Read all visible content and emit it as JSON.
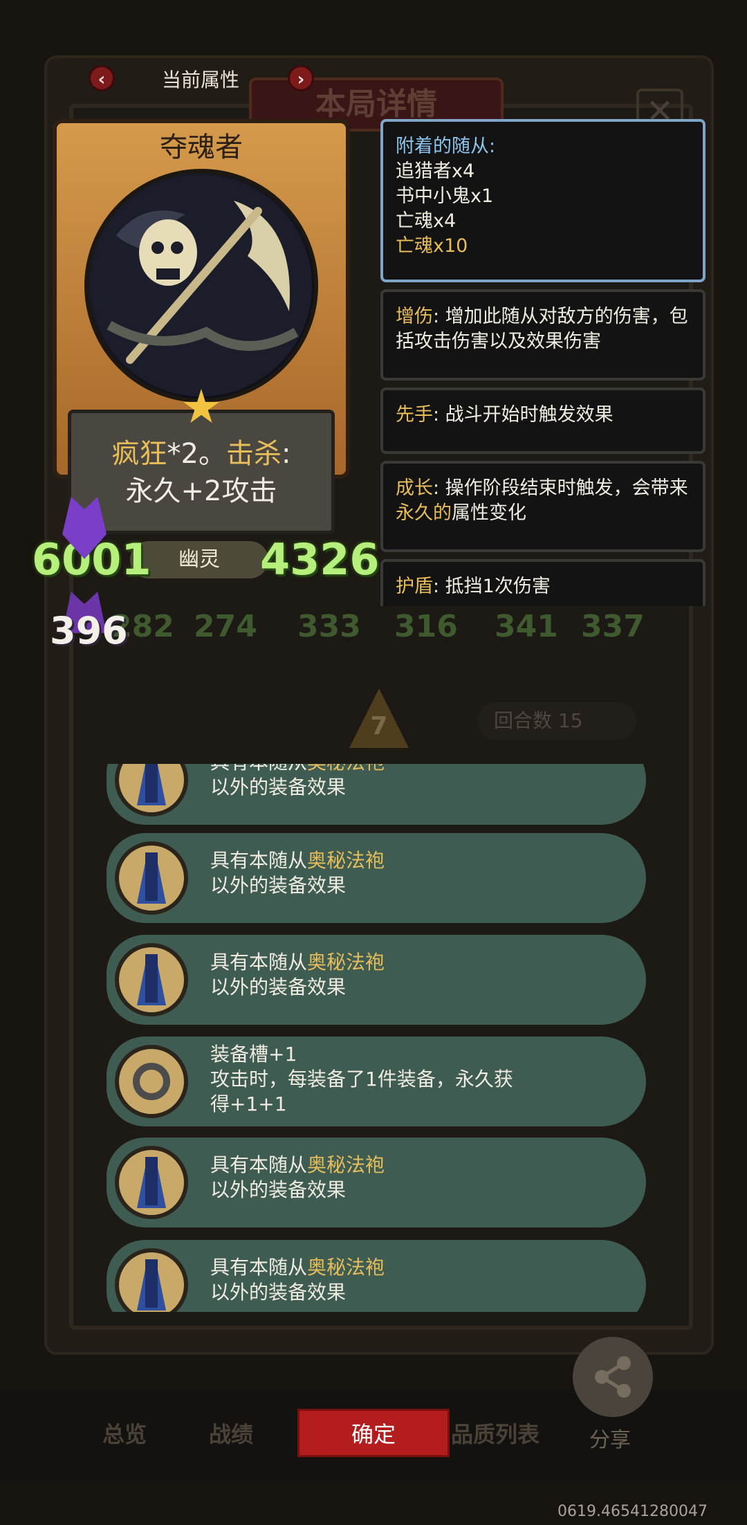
{
  "header": {
    "title": "当前属性",
    "prev_glyph": "‹",
    "next_glyph": "›"
  },
  "background": {
    "title": "本局详情",
    "close_glyph": "✕",
    "arrow_value": "7",
    "rounds_label": "回合数 15",
    "board_numbers": [
      "282",
      "274",
      "333",
      "316",
      "341",
      "337"
    ]
  },
  "unit": {
    "name": "夺魂者",
    "ability_line1_parts": [
      "疯狂",
      "*2。",
      "击杀",
      ":"
    ],
    "ability_line2": "永久+2攻击",
    "type": "幽灵",
    "attack": "6001",
    "health": "4326",
    "secondary_stat": "396",
    "star_icon": "star-icon"
  },
  "attached": {
    "heading": "附着的随从:",
    "items": [
      "追猎者x4",
      "书中小鬼x1",
      "亡魂x4"
    ],
    "highlight_item": "亡魂x10"
  },
  "keywords": [
    {
      "name": "增伤",
      "text": ": 增加此随从对敌方的伤害，包括攻击伤害以及效果伤害"
    },
    {
      "name": "先手",
      "text": ": 战斗开始时触发效果"
    },
    {
      "name": "成长",
      "text_before": ": 操作阶段结束时触发，会带来",
      "highlight": "永久的",
      "text_after": "属性变化"
    },
    {
      "name": "护盾",
      "text": ": 抵挡1次伤害"
    }
  ],
  "equipment": [
    {
      "icon": "robe-icon",
      "prefix": "具有本随从",
      "highlight": "奥秘法袍",
      "line2": "以外的装备效果"
    },
    {
      "icon": "robe-icon",
      "prefix": "具有本随从",
      "highlight": "奥秘法袍",
      "line2": "以外的装备效果"
    },
    {
      "icon": "robe-icon",
      "prefix": "具有本随从",
      "highlight": "奥秘法袍",
      "line2": "以外的装备效果"
    },
    {
      "icon": "horseshoe-icon",
      "prefix": "装备槽+1",
      "highlight": "",
      "line2": "攻击时，每装备了1件装备，永久获",
      "line3": "得+1+1"
    },
    {
      "icon": "robe-icon",
      "prefix": "具有本随从",
      "highlight": "奥秘法袍",
      "line2": "以外的装备效果"
    },
    {
      "icon": "robe-icon",
      "prefix": "具有本随从",
      "highlight": "奥秘法袍",
      "line2": "以外的装备效果"
    }
  ],
  "bottom": {
    "tabs": [
      "总览",
      "战绩",
      "品质列表"
    ],
    "confirm_label": "确定",
    "share_label": "分享",
    "share_icon": "share-icon"
  },
  "version": "0619.46541280047",
  "colors": {
    "gold": "#e8be5a",
    "stat_green": "#b6ef7b",
    "confirm_red": "#b41d1d",
    "row_green": "#3e5c51",
    "attached_blue": "#8cc6ee"
  }
}
